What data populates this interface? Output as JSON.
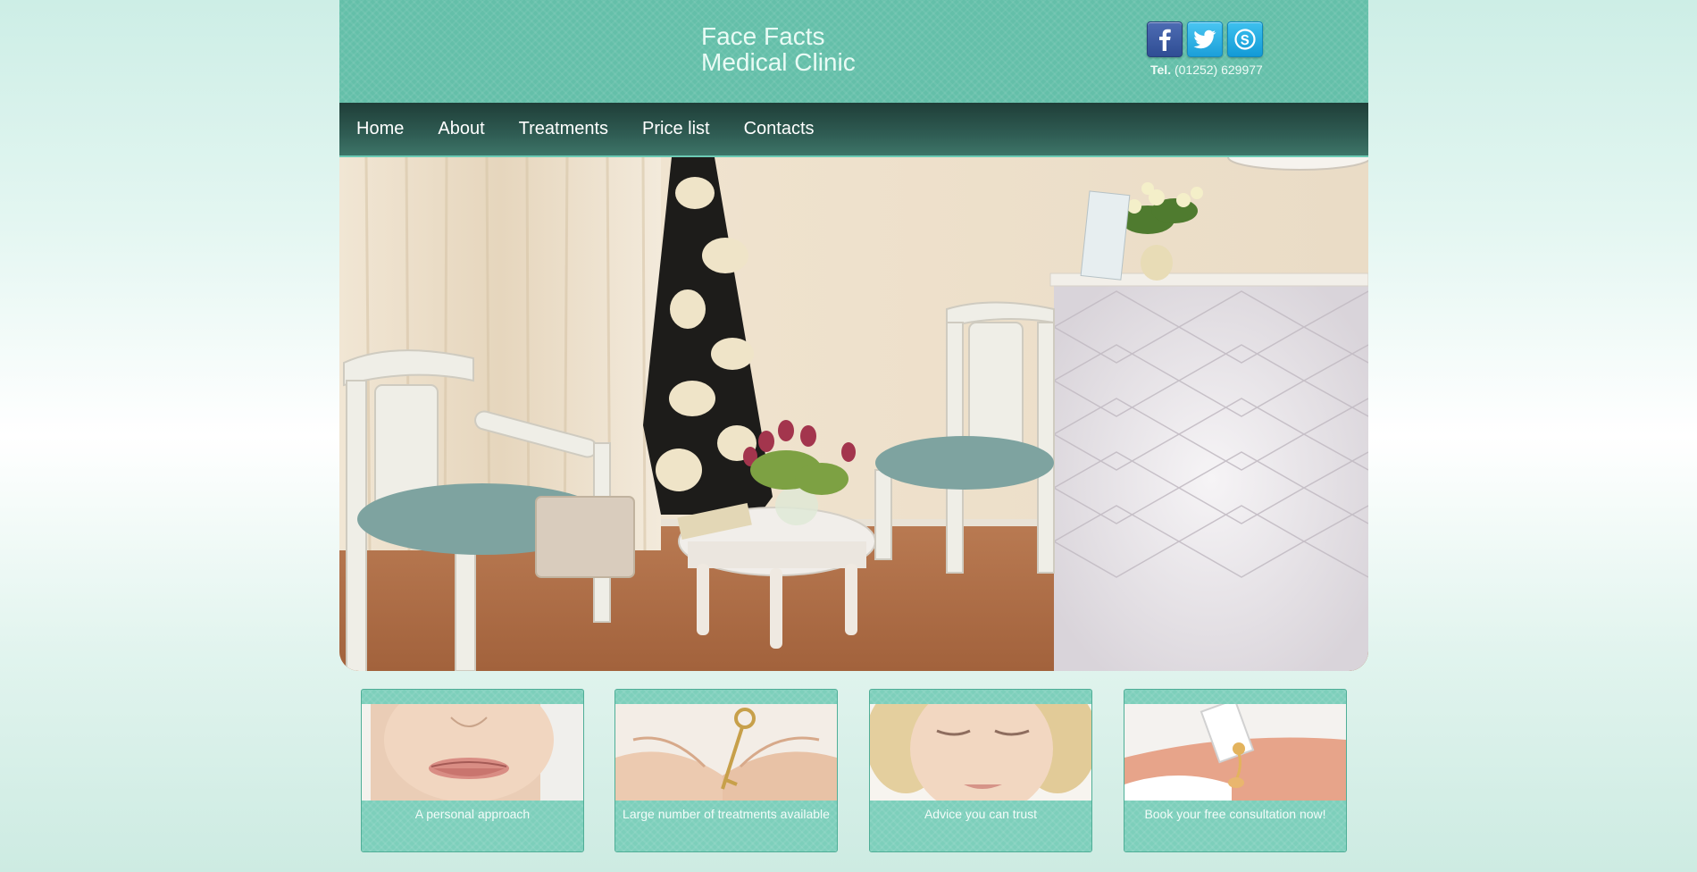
{
  "brand": {
    "line1": "Face Facts",
    "line2": "Medical Clinic"
  },
  "social": {
    "facebook_icon": "facebook-icon",
    "twitter_icon": "twitter-icon",
    "skype_icon": "skype-icon"
  },
  "contact": {
    "tel_label": "Tel.",
    "tel_number": "(01252) 629977"
  },
  "nav": {
    "items": [
      {
        "label": "Home"
      },
      {
        "label": "About"
      },
      {
        "label": "Treatments"
      },
      {
        "label": "Price list"
      },
      {
        "label": "Contacts"
      }
    ]
  },
  "cards": [
    {
      "caption": "A personal approach"
    },
    {
      "caption": "Large number of treatments available"
    },
    {
      "caption": "Advice you can trust"
    },
    {
      "caption": "Book your free consultation now!"
    }
  ],
  "colors": {
    "header": "#64bfa9",
    "nav_dark": "#1f3e38",
    "card": "#7dcfbb"
  }
}
